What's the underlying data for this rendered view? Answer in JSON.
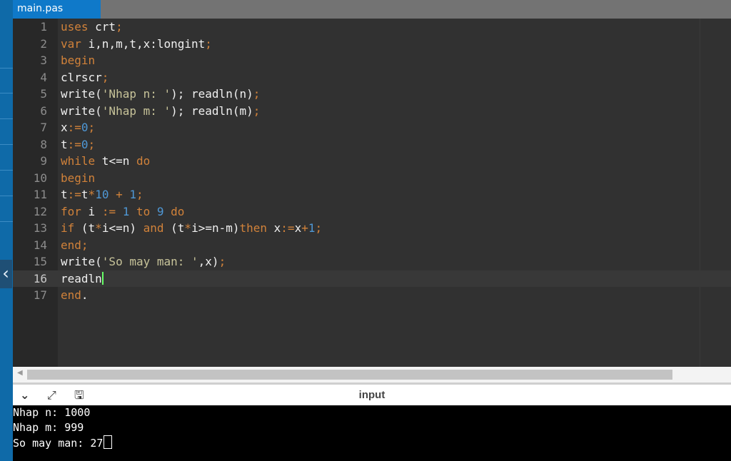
{
  "tabs": {
    "active_label": "main.pas"
  },
  "editor": {
    "lines": [
      {
        "n": "1"
      },
      {
        "n": "2"
      },
      {
        "n": "3"
      },
      {
        "n": "4"
      },
      {
        "n": "5"
      },
      {
        "n": "6"
      },
      {
        "n": "7"
      },
      {
        "n": "8"
      },
      {
        "n": "9"
      },
      {
        "n": "10"
      },
      {
        "n": "11"
      },
      {
        "n": "12"
      },
      {
        "n": "13"
      },
      {
        "n": "14"
      },
      {
        "n": "15"
      },
      {
        "n": "16"
      },
      {
        "n": "17"
      }
    ],
    "tokens": {
      "l1": [
        "uses",
        " crt",
        ";"
      ],
      "l2": [
        "var",
        " i,n,m,t,x:longint",
        ";"
      ],
      "l3": [
        "begin"
      ],
      "l4": [
        "clrscr",
        ";"
      ],
      "l5": [
        "write(",
        "'Nhap n: '",
        "); readln(n)",
        ";"
      ],
      "l6": [
        "write(",
        "'Nhap m: '",
        "); readln(m)",
        ";"
      ],
      "l7": [
        "x",
        ":=",
        "0",
        ";"
      ],
      "l8": [
        "t",
        ":=",
        "0",
        ";"
      ],
      "l9": [
        "while",
        " t<=n ",
        "do"
      ],
      "l10": [
        "begin"
      ],
      "l11": [
        "t",
        ":=",
        "t",
        "*",
        "10",
        " + ",
        "1",
        ";"
      ],
      "l12": [
        "for",
        " i ",
        ":=",
        " 1 ",
        "to",
        " 9 ",
        "do"
      ],
      "l13": [
        "if",
        " (t",
        "*",
        "i<=n) ",
        "and",
        " (t",
        "*",
        "i>=n-m)",
        "then",
        " x",
        ":=",
        "x",
        "+",
        "1",
        ";"
      ],
      "l14": [
        "end",
        ";"
      ],
      "l15": [
        "write(",
        "'So may man: '",
        ",x)",
        ";"
      ],
      "l16": [
        "readln"
      ],
      "l17": [
        "end",
        "."
      ]
    }
  },
  "console": {
    "title": "input",
    "collapse_icon": "chevron-down-icon",
    "expand_icon": "expand-arrows-icon",
    "clear_icon": "clear-console-icon",
    "collapse_glyph": "⌄",
    "expand_glyph": "⤢",
    "clear_glyph": "🖫",
    "output": [
      "Nhap n: 1000",
      "Nhap m: 999",
      "So may man: 27"
    ]
  },
  "sidebar": {
    "toggle_glyph": "‹",
    "toggle_icon": "chevron-left-icon"
  },
  "colors": {
    "keyword": "#d1823a",
    "number": "#4f98d6",
    "string": "#c8c49a",
    "accent": "#0f79c9"
  }
}
